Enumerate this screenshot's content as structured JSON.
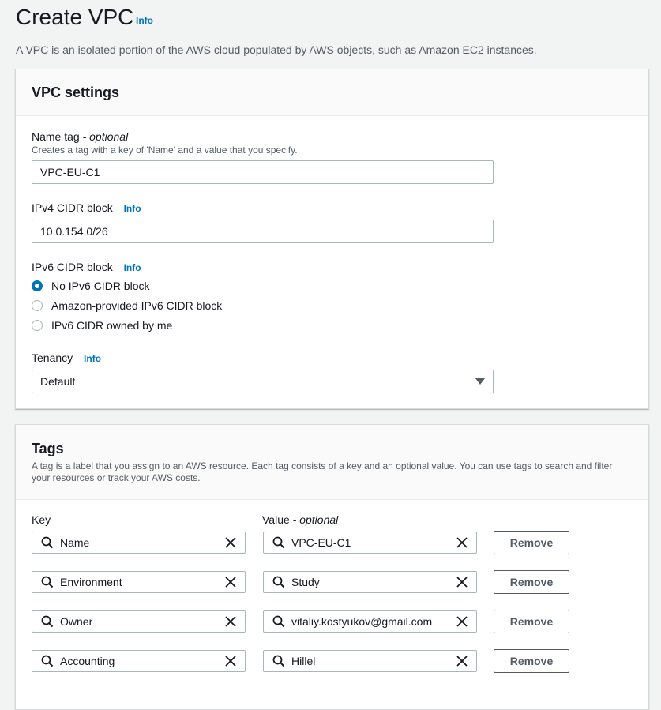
{
  "header": {
    "title": "Create VPC",
    "info_label": "Info",
    "description": "A VPC is an isolated portion of the AWS cloud populated by AWS objects, such as Amazon EC2 instances."
  },
  "vpc_settings": {
    "title": "VPC settings",
    "name_tag": {
      "label": "Name tag",
      "optional": "- optional",
      "hint": "Creates a tag with a key of 'Name' and a value that you specify.",
      "value": "VPC-EU-C1"
    },
    "ipv4": {
      "label": "IPv4 CIDR block",
      "info": "Info",
      "value": "10.0.154.0/26"
    },
    "ipv6": {
      "label": "IPv6 CIDR block",
      "info": "Info",
      "options": [
        {
          "label": "No IPv6 CIDR block",
          "selected": true
        },
        {
          "label": "Amazon-provided IPv6 CIDR block",
          "selected": false
        },
        {
          "label": "IPv6 CIDR owned by me",
          "selected": false
        }
      ]
    },
    "tenancy": {
      "label": "Tenancy",
      "info": "Info",
      "value": "Default"
    }
  },
  "tags": {
    "title": "Tags",
    "description": "A tag is a label that you assign to an AWS resource. Each tag consists of a key and an optional value. You can use tags to search and filter your resources or track your AWS costs.",
    "key_header": "Key",
    "value_header": "Value",
    "value_optional": "- optional",
    "remove_label": "Remove",
    "rows": [
      {
        "key": "Name",
        "value": "VPC-EU-C1"
      },
      {
        "key": "Environment",
        "value": "Study"
      },
      {
        "key": "Owner",
        "value": "vitaliy.kostyukov@gmail.com"
      },
      {
        "key": "Accounting",
        "value": "Hillel"
      }
    ]
  },
  "colors": {
    "accent": "#0073bb",
    "background": "#f2f3f3",
    "text": "#16191f",
    "muted": "#545b64"
  }
}
